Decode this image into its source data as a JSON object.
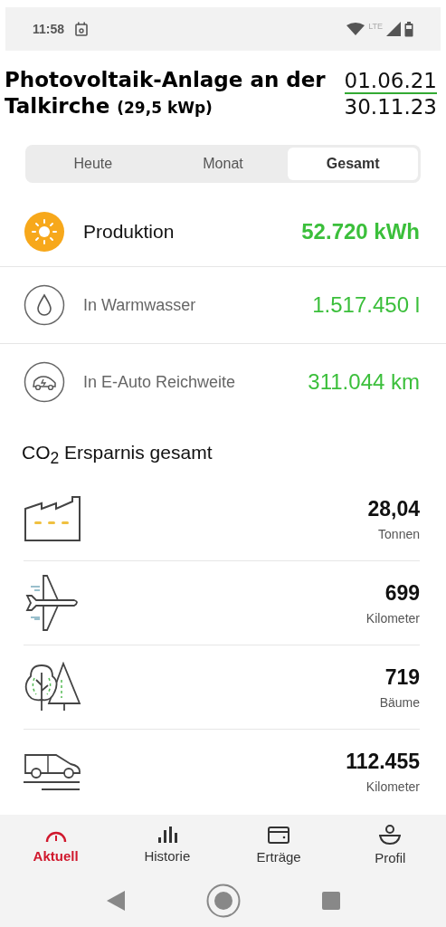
{
  "status_bar": {
    "time": "11:58",
    "network": "LTE"
  },
  "header": {
    "title": "Photovoltaik-Anlage an der Talkirche",
    "capacity": "(29,5 kWp)",
    "date_from": "01.06.21",
    "date_to": "30.11.23"
  },
  "tabs": [
    {
      "label": "Heute",
      "selected": false
    },
    {
      "label": "Monat",
      "selected": false
    },
    {
      "label": "Gesamt",
      "selected": true
    }
  ],
  "stats": [
    {
      "kind": "sun",
      "label": "Produktion",
      "value": "52.720 kWh",
      "primary": true
    },
    {
      "kind": "drop",
      "label": "In Warmwasser",
      "value": "1.517.450 l",
      "primary": false
    },
    {
      "kind": "ecar",
      "label": "In E-Auto Reichweite",
      "value": "311.044 km",
      "primary": false
    }
  ],
  "co2_heading": "CO$_{2}$ Ersparnis gesamt",
  "savings": [
    {
      "kind": "factory",
      "value": "28,04",
      "unit": "Tonnen"
    },
    {
      "kind": "plane",
      "value": "699",
      "unit": "Kilometer"
    },
    {
      "kind": "trees",
      "value": "719",
      "unit": "Bäume"
    },
    {
      "kind": "car",
      "value": "112.455",
      "unit": "Kilometer"
    }
  ],
  "nav": [
    {
      "kind": "gauge",
      "label": "Aktuell",
      "selected": true
    },
    {
      "kind": "bars",
      "label": "Historie",
      "selected": false
    },
    {
      "kind": "wallet",
      "label": "Erträge",
      "selected": false
    },
    {
      "kind": "profile",
      "label": "Profil",
      "selected": false
    }
  ]
}
